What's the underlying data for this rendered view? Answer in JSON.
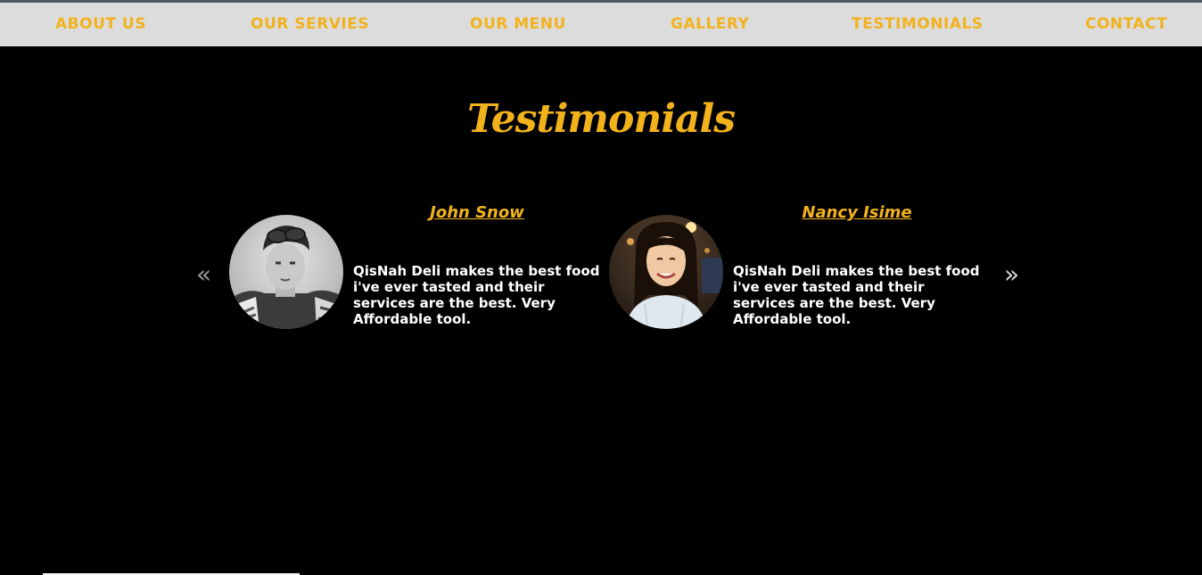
{
  "nav": {
    "items": [
      {
        "label": "ABOUT US"
      },
      {
        "label": "OUR SERVIES"
      },
      {
        "label": "OUR MENU"
      },
      {
        "label": "GALLERY"
      },
      {
        "label": "TESTIMONIALS"
      },
      {
        "label": "CONTACT"
      }
    ]
  },
  "testimonials": {
    "title": "Testimonials",
    "prev_glyph": "«",
    "next_glyph": "»",
    "items": [
      {
        "name": "John Snow",
        "quote": "QisNah Deli makes the best food i've ever tasted and their services are the best. Very Affordable tool."
      },
      {
        "name": "Nancy Isime",
        "quote": "QisNah Deli makes the best food i've ever tasted and their services are the best. Very Affordable tool."
      }
    ]
  },
  "colors": {
    "accent": "#f2b21c",
    "nav_background": "#dcdcdc",
    "page_background": "#000000",
    "text": "#ffffff"
  }
}
